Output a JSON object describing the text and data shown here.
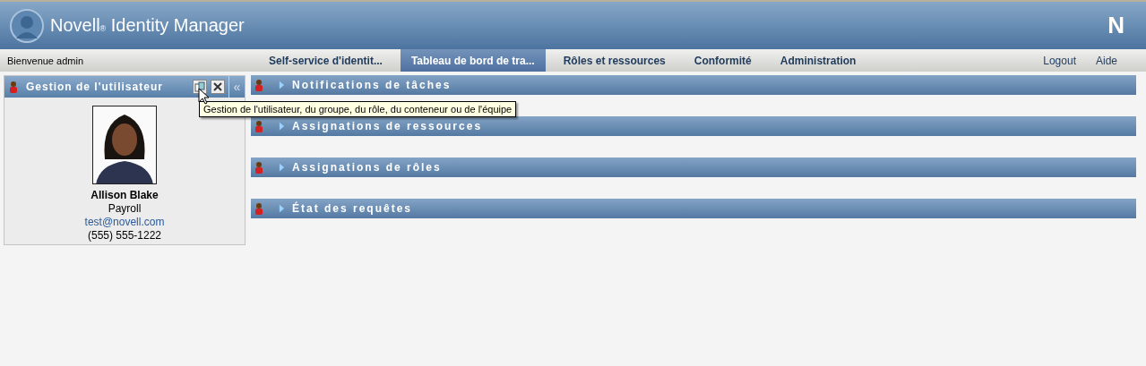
{
  "header": {
    "brand": "Novell",
    "reg": "®",
    "product": "Identity Manager",
    "logo_letter": "N"
  },
  "nav": {
    "welcome": "Bienvenue admin",
    "tabs": [
      {
        "label": "Self-service d'identit...",
        "selected": false
      },
      {
        "label": "Tableau de bord de tra...",
        "selected": true
      },
      {
        "label": "Rôles et ressources",
        "selected": false
      },
      {
        "label": "Conformité",
        "selected": false
      },
      {
        "label": "Administration",
        "selected": false
      }
    ],
    "links": [
      "Logout",
      "Aide"
    ]
  },
  "user_panel": {
    "title": "Gestion de l'utilisateur",
    "collapse": "«",
    "name": "Allison Blake",
    "department": "Payroll",
    "email": "test@novell.com",
    "phone": "(555) 555-1222"
  },
  "tooltip": "Gestion de l'utilisateur, du groupe, du rôle, du conteneur ou de l'équipe",
  "sections": [
    {
      "title": "Notifications de tâches",
      "expanded": false
    },
    {
      "title": "Assignations de ressources",
      "expanded": false
    },
    {
      "title": "Assignations de rôles",
      "expanded": false
    },
    {
      "title": "État des requêtes",
      "expanded": false
    }
  ]
}
